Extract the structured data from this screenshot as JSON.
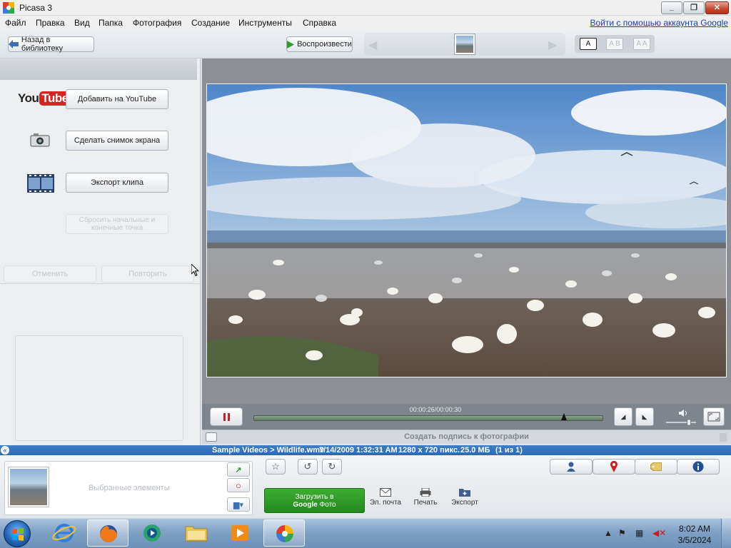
{
  "window": {
    "title": "Picasa 3"
  },
  "menu": {
    "items": [
      "Файл",
      "Правка",
      "Вид",
      "Папка",
      "Фотография",
      "Создание",
      "Инструменты",
      "Справка"
    ],
    "signin": "Войти с помощью аккаунта Google"
  },
  "toolbar": {
    "back_label": "Назад в библиотеку",
    "play_label": "Воспроизвести",
    "view_modes": [
      "A",
      "A B",
      "A A"
    ]
  },
  "left_panel": {
    "youtube_logo": [
      "You",
      "Tube"
    ],
    "youtube_button": "Добавить на YouTube",
    "screenshot_button": "Сделать снимок экрана",
    "export_clip_button": "Экспорт клипа",
    "reset_points_button": "Сбросить начальные и конечные точка",
    "undo_button": "Отменить",
    "redo_button": "Повторить"
  },
  "player": {
    "timecode": "00:00:26/00:00:30",
    "progress": 0.89,
    "volume": 0.8
  },
  "caption": {
    "placeholder": "Создать подпись к фотографии"
  },
  "infobar": {
    "path": "Sample Videos > Wildlife.wmv",
    "date": "7/14/2009 1:32:31 AM",
    "dimensions": "1280 x 720 пикс.",
    "size": "25.0 МБ",
    "count": "(1 из 1)"
  },
  "tray": {
    "selected_label": "Выбранные элементы",
    "upload_line1": "Загрузить в",
    "upload_line2": "Google",
    "upload_line3": "Фото",
    "email_label": "Эл. почта",
    "print_label": "Печать",
    "export_label": "Экспорт"
  },
  "taskbar": {
    "time": "8:02 AM",
    "date": "3/5/2024"
  },
  "colors": {
    "accent_blue": "#2d69b0",
    "upload_green": "#2f9e27",
    "pause_red": "#d21d1d"
  }
}
